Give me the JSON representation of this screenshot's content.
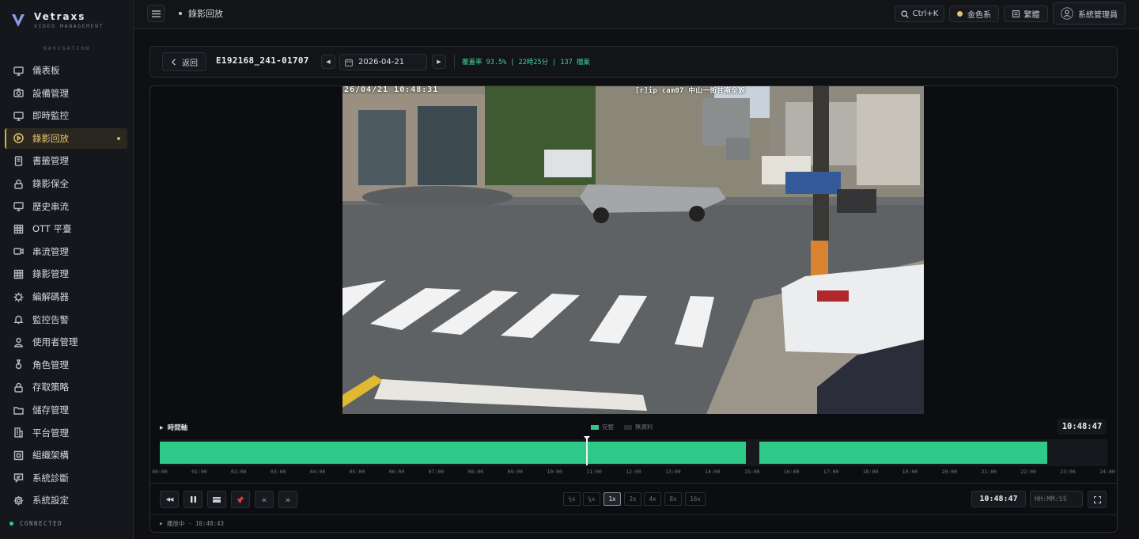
{
  "brand": {
    "name": "Vetraxs",
    "subtitle": "VIDEO MANAGEMENT"
  },
  "nav": {
    "heading": "NAVIGATION",
    "items": [
      {
        "label": "儀表板",
        "icon": "monitor-icon"
      },
      {
        "label": "設備管理",
        "icon": "camera-icon"
      },
      {
        "label": "即時監控",
        "icon": "monitor-icon"
      },
      {
        "label": "錄影回放",
        "icon": "play-circle-icon",
        "active": true
      },
      {
        "label": "書籤管理",
        "icon": "bookmark-icon"
      },
      {
        "label": "錄影保全",
        "icon": "lock-icon"
      },
      {
        "label": "歷史串流",
        "icon": "monitor-icon"
      },
      {
        "label": "OTT 平臺",
        "icon": "grid-icon"
      },
      {
        "label": "串流管理",
        "icon": "video-icon"
      },
      {
        "label": "錄影管理",
        "icon": "grid-icon"
      },
      {
        "label": "編解碼器",
        "icon": "chip-icon"
      },
      {
        "label": "監控告警",
        "icon": "bell-icon"
      },
      {
        "label": "使用者管理",
        "icon": "user-icon"
      },
      {
        "label": "角色管理",
        "icon": "role-icon"
      },
      {
        "label": "存取策略",
        "icon": "lock-icon"
      },
      {
        "label": "儲存管理",
        "icon": "folder-icon"
      },
      {
        "label": "平台管理",
        "icon": "building-icon"
      },
      {
        "label": "組織架構",
        "icon": "org-icon"
      },
      {
        "label": "系統診斷",
        "icon": "chat-icon"
      },
      {
        "label": "系統設定",
        "icon": "gear-icon"
      }
    ]
  },
  "status": {
    "connection": "CONNECTED"
  },
  "topbar": {
    "breadcrumb": "錄影回放",
    "search_shortcut": "Ctrl+K",
    "theme": "金色系",
    "language": "繁體",
    "user": "系統管理員"
  },
  "toolbar": {
    "back": "返回",
    "camera_id": "E192168_241-01707",
    "date": "2026-04-21",
    "coverage": "覆蓋率 93.5% | 22時25分 | 137 檔案"
  },
  "video": {
    "osd_time": "26/04/21 10:48:31",
    "osd_camera": "[r]ip cam07 中山一街甘南全貌"
  },
  "timeline": {
    "label": "時間軸",
    "legend_complete": "完整",
    "legend_none": "無資料",
    "current_time": "10:48:47",
    "ticks": [
      "00:00",
      "01:00",
      "02:00",
      "03:00",
      "04:00",
      "05:00",
      "06:00",
      "07:00",
      "08:00",
      "09:00",
      "10:00",
      "11:00",
      "12:00",
      "13:00",
      "14:00",
      "15:00",
      "16:00",
      "17:00",
      "18:00",
      "19:00",
      "20:00",
      "21:00",
      "22:00",
      "23:00",
      "24:00"
    ],
    "playhead_hour": 10.81,
    "segments": [
      [
        0,
        10.81
      ],
      [
        10.81,
        14.87
      ],
      [
        15.18,
        24
      ]
    ]
  },
  "controls": {
    "speeds": [
      "½x",
      "¼x",
      "1x",
      "2x",
      "4x",
      "8x",
      "16x"
    ],
    "active_speed": "1x",
    "time_display": "10:48:47",
    "time_placeholder": "HH:MM:SS"
  },
  "footer": {
    "status": "播放中 · 10:48:43"
  }
}
